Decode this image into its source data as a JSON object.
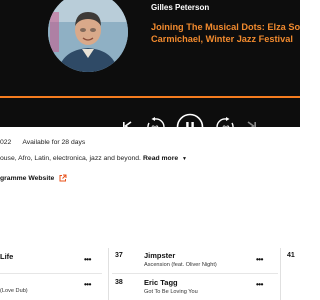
{
  "player": {
    "presenter": "Gilles Peterson",
    "title_line1": "Joining The Musical Dots: Elza Soares",
    "title_line2": "Carmichael, Winter Jazz Festival",
    "progress_fraction": 1.0,
    "colors": {
      "accent": "#f57c1f",
      "title": "#f18a2e",
      "background": "#0d0d0d"
    },
    "controls": {
      "previous_icon": "skip-previous-icon",
      "rewind_label": "20",
      "play_icon": "pause-icon",
      "forward_label": "20",
      "next_icon": "skip-next-icon"
    }
  },
  "episode": {
    "date_fragment": "022",
    "availability": "Available for 28 days",
    "description_fragment": "ouse, Afro, Latin, electronica, jazz and beyond.",
    "read_more": "Read more",
    "programme_link": "gramme Website"
  },
  "tracklist": [
    {
      "number": "",
      "artist": "Life",
      "track": "(Love Dub)"
    },
    {
      "number": "37",
      "artist": "Jimpster",
      "track": "Ascension (feat. Oliver Night)"
    },
    {
      "number": "38",
      "artist": "Eric Tagg",
      "track": "Got To Be Loving You"
    },
    {
      "number": "41",
      "artist": "",
      "track": ""
    }
  ],
  "more_icon": "more-options-icon"
}
